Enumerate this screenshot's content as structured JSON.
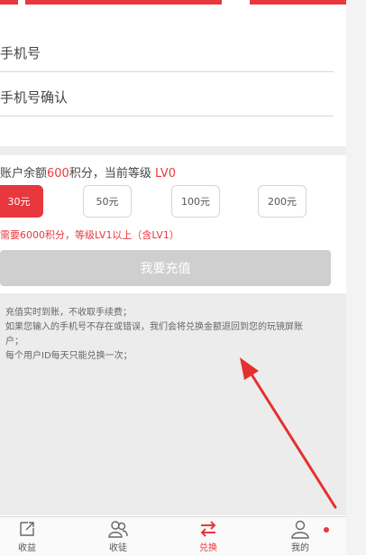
{
  "form": {
    "phone_label": "手机号",
    "phone_confirm_label": "手机号确认"
  },
  "balance": {
    "prefix": "账户余额",
    "points": "600",
    "middle": "积分，当前等级",
    "level": "LV0"
  },
  "amounts": [
    {
      "label": "30元",
      "selected": true
    },
    {
      "label": "50元",
      "selected": false
    },
    {
      "label": "100元",
      "selected": false
    },
    {
      "label": "200元",
      "selected": false
    }
  ],
  "requirement": "需要6000积分，等级LV1以上（含LV1）",
  "recharge_button": "我要充值",
  "notes": [
    "充值实时到账，不收取手续费；",
    "如果您输入的手机号不存在或错误，我们会将兑换金额退回到您的玩镜屏账",
    "户；",
    "每个用户ID每天只能兑换一次；"
  ],
  "tabs": [
    {
      "label": "收益",
      "icon": "earnings-icon"
    },
    {
      "label": "收徒",
      "icon": "apprentice-icon"
    },
    {
      "label": "兑换",
      "icon": "exchange-icon",
      "active": true
    },
    {
      "label": "我的",
      "icon": "profile-icon"
    }
  ],
  "colors": {
    "accent": "#e8383d",
    "disabled": "#cfcfcf",
    "notes_bg": "#ececec"
  }
}
